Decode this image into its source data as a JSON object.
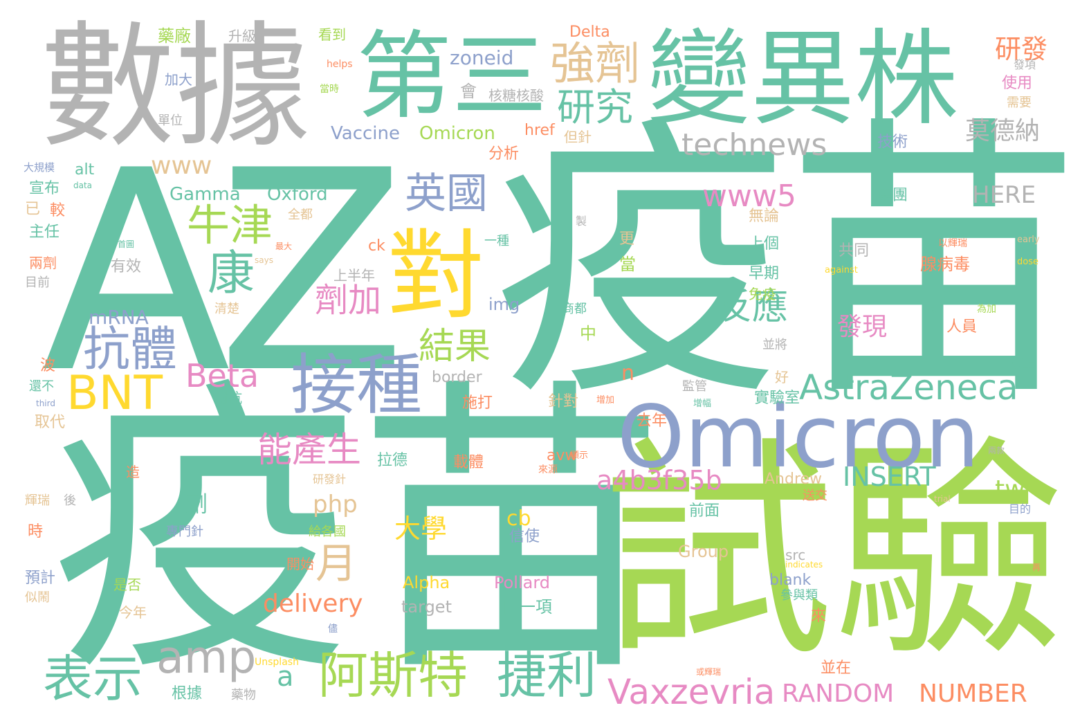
{
  "colors": {
    "teal": "#66c2a5",
    "green": "#a6d854",
    "gray": "#b3b3b3",
    "blue": "#8da0cb",
    "yellow": "#ffd92f",
    "tan": "#e5c494",
    "pink": "#e78ac3",
    "orange": "#fc8d62"
  },
  "words": [
    {
      "text": "AZ",
      "color": "teal"
    },
    {
      "text": "疫苗",
      "color": "teal"
    },
    {
      "text": "疫苗",
      "color": "teal"
    },
    {
      "text": "試驗",
      "color": "green"
    },
    {
      "text": "變異株",
      "color": "teal"
    },
    {
      "text": "數據",
      "color": "gray"
    },
    {
      "text": "第三",
      "color": "teal"
    },
    {
      "text": "Omicron",
      "color": "blue"
    },
    {
      "text": "對",
      "color": "yellow"
    },
    {
      "text": "接種",
      "color": "blue"
    },
    {
      "text": "強劑",
      "color": "tan"
    },
    {
      "text": "研究",
      "color": "teal"
    },
    {
      "text": "英國",
      "color": "blue"
    },
    {
      "text": "牛津",
      "color": "green"
    },
    {
      "text": "康",
      "color": "teal"
    },
    {
      "text": "抗體",
      "color": "blue"
    },
    {
      "text": "BNT",
      "color": "yellow"
    },
    {
      "text": "表示",
      "color": "teal"
    },
    {
      "text": "amp",
      "color": "gray"
    },
    {
      "text": "阿斯特",
      "color": "green"
    },
    {
      "text": "捷利",
      "color": "teal"
    },
    {
      "text": "Vaxzevria",
      "color": "pink"
    },
    {
      "text": "AstraZeneca",
      "color": "teal"
    },
    {
      "text": "technews",
      "color": "gray"
    },
    {
      "text": "www5",
      "color": "pink"
    },
    {
      "text": "反應",
      "color": "teal"
    },
    {
      "text": "結果",
      "color": "green"
    },
    {
      "text": "劑加",
      "color": "pink"
    },
    {
      "text": "Beta",
      "color": "pink"
    },
    {
      "text": "能產生",
      "color": "pink"
    },
    {
      "text": "www",
      "color": "tan"
    },
    {
      "text": "月",
      "color": "tan"
    },
    {
      "text": "研發",
      "color": "orange"
    },
    {
      "text": "莫德納",
      "color": "gray"
    },
    {
      "text": "a4b3f35b",
      "color": "pink"
    },
    {
      "text": "INSERT",
      "color": "teal"
    },
    {
      "text": "RANDOM",
      "color": "pink"
    },
    {
      "text": "NUMBER",
      "color": "orange"
    },
    {
      "text": "delivery",
      "color": "orange"
    },
    {
      "text": "tw",
      "color": "green"
    },
    {
      "text": "a",
      "color": "teal"
    },
    {
      "text": "php",
      "color": "tan"
    },
    {
      "text": "大學",
      "color": "yellow"
    },
    {
      "text": "發現",
      "color": "pink"
    },
    {
      "text": "HERE",
      "color": "gray"
    },
    {
      "text": "zoneid",
      "color": "blue"
    },
    {
      "text": "Vaccine",
      "color": "blue"
    },
    {
      "text": "Omicron",
      "color": "green"
    },
    {
      "text": "Gamma",
      "color": "teal"
    },
    {
      "text": "Oxford",
      "color": "teal"
    },
    {
      "text": "mRNA",
      "color": "blue"
    },
    {
      "text": "Delta",
      "color": "orange"
    },
    {
      "text": "藥廠",
      "color": "green"
    },
    {
      "text": "升級",
      "color": "gray"
    },
    {
      "text": "看到",
      "color": "green"
    },
    {
      "text": "加大",
      "color": "blue"
    },
    {
      "text": "會",
      "color": "gray"
    },
    {
      "text": "核糖核酸",
      "color": "gray"
    },
    {
      "text": "單位",
      "color": "gray"
    },
    {
      "text": "href",
      "color": "orange"
    },
    {
      "text": "但針",
      "color": "tan"
    },
    {
      "text": "技術",
      "color": "blue"
    },
    {
      "text": "分析",
      "color": "orange"
    },
    {
      "text": "alt",
      "color": "teal"
    },
    {
      "text": "大規模",
      "color": "blue"
    },
    {
      "text": "宣布",
      "color": "teal"
    },
    {
      "text": "已",
      "color": "tan"
    },
    {
      "text": "較",
      "color": "orange"
    },
    {
      "text": "主任",
      "color": "teal"
    },
    {
      "text": "兩劑",
      "color": "orange"
    },
    {
      "text": "目前",
      "color": "gray"
    },
    {
      "text": "有效",
      "color": "gray"
    },
    {
      "text": "ck",
      "color": "orange"
    },
    {
      "text": "上半年",
      "color": "gray"
    },
    {
      "text": "清楚",
      "color": "tan"
    },
    {
      "text": "img",
      "color": "blue"
    },
    {
      "text": "一種",
      "color": "teal"
    },
    {
      "text": "更",
      "color": "tan"
    },
    {
      "text": "當",
      "color": "green"
    },
    {
      "text": "無論",
      "color": "tan"
    },
    {
      "text": "上個",
      "color": "teal"
    },
    {
      "text": "早期",
      "color": "teal"
    },
    {
      "text": "免疫",
      "color": "green"
    },
    {
      "text": "共同",
      "color": "gray"
    },
    {
      "text": "腺病毒",
      "color": "orange"
    },
    {
      "text": "人員",
      "color": "orange"
    },
    {
      "text": "集團",
      "color": "teal"
    },
    {
      "text": "使用",
      "color": "pink"
    },
    {
      "text": "需要",
      "color": "tan"
    },
    {
      "text": "發項",
      "color": "gray"
    },
    {
      "text": "商都",
      "color": "teal"
    },
    {
      "text": "中",
      "color": "green"
    },
    {
      "text": "並將",
      "color": "gray"
    },
    {
      "text": "康上",
      "color": "teal"
    },
    {
      "text": "波",
      "color": "orange"
    },
    {
      "text": "還不",
      "color": "teal"
    },
    {
      "text": "取代",
      "color": "tan"
    },
    {
      "text": "border",
      "color": "gray"
    },
    {
      "text": "n",
      "color": "orange"
    },
    {
      "text": "施打",
      "color": "orange"
    },
    {
      "text": "針對",
      "color": "tan"
    },
    {
      "text": "監管",
      "color": "gray"
    },
    {
      "text": "好",
      "color": "tan"
    },
    {
      "text": "實驗室",
      "color": "teal"
    },
    {
      "text": "對抗",
      "color": "teal"
    },
    {
      "text": "去年",
      "color": "orange"
    },
    {
      "text": "拉德",
      "color": "teal"
    },
    {
      "text": "載體",
      "color": "orange"
    },
    {
      "text": "avw",
      "color": "orange"
    },
    {
      "text": "劑",
      "color": "teal"
    },
    {
      "text": "造",
      "color": "orange"
    },
    {
      "text": "輝瑞",
      "color": "tan"
    },
    {
      "text": "後",
      "color": "gray"
    },
    {
      "text": "時",
      "color": "orange"
    },
    {
      "text": "預計",
      "color": "blue"
    },
    {
      "text": "似鬧",
      "color": "tan"
    },
    {
      "text": "cb",
      "color": "yellow"
    },
    {
      "text": "信使",
      "color": "blue"
    },
    {
      "text": "前面",
      "color": "teal"
    },
    {
      "text": "Andrew",
      "color": "tan"
    },
    {
      "text": "送交",
      "color": "orange"
    },
    {
      "text": "Group",
      "color": "tan"
    },
    {
      "text": "src",
      "color": "gray"
    },
    {
      "text": "blank",
      "color": "blue"
    },
    {
      "text": "參與類",
      "color": "teal"
    },
    {
      "text": "來",
      "color": "orange"
    },
    {
      "text": "Alpha",
      "color": "yellow"
    },
    {
      "text": "Pollard",
      "color": "pink"
    },
    {
      "text": "target",
      "color": "gray"
    },
    {
      "text": "自一項",
      "color": "teal"
    },
    {
      "text": "給各國",
      "color": "green"
    },
    {
      "text": "專門針",
      "color": "blue"
    },
    {
      "text": "開始",
      "color": "orange"
    },
    {
      "text": "是否",
      "color": "green"
    },
    {
      "text": "今年",
      "color": "tan"
    },
    {
      "text": "並在",
      "color": "orange"
    },
    {
      "text": "根據",
      "color": "teal"
    },
    {
      "text": "藥物",
      "color": "gray"
    },
    {
      "text": "全都",
      "color": "tan"
    },
    {
      "text": "研發針",
      "color": "tan"
    },
    {
      "text": "data",
      "color": "teal"
    },
    {
      "text": "third",
      "color": "blue"
    },
    {
      "text": "says",
      "color": "tan"
    },
    {
      "text": "early",
      "color": "tan"
    },
    {
      "text": "dose",
      "color": "yellow"
    },
    {
      "text": "against",
      "color": "yellow"
    },
    {
      "text": "indicates",
      "color": "yellow"
    },
    {
      "text": "trial",
      "color": "tan"
    },
    {
      "text": "helps",
      "color": "orange"
    },
    {
      "text": "Unsplash",
      "color": "yellow"
    },
    {
      "text": "當時",
      "color": "green"
    },
    {
      "text": "首圖",
      "color": "teal"
    },
    {
      "text": "最大",
      "color": "orange"
    },
    {
      "text": "製",
      "color": "gray"
    },
    {
      "text": "以輝瑞",
      "color": "orange"
    },
    {
      "text": "為",
      "color": "teal"
    },
    {
      "text": "為加",
      "color": "green"
    },
    {
      "text": "增加",
      "color": "orange"
    },
    {
      "text": "增幅",
      "color": "teal"
    },
    {
      "text": "顯示",
      "color": "orange"
    },
    {
      "text": "來源",
      "color": "orange"
    },
    {
      "text": "兩款",
      "color": "gray"
    },
    {
      "text": "目的",
      "color": "blue"
    },
    {
      "text": "再",
      "color": "orange"
    },
    {
      "text": "或輝瑞",
      "color": "orange"
    },
    {
      "text": "儘",
      "color": "blue"
    }
  ]
}
